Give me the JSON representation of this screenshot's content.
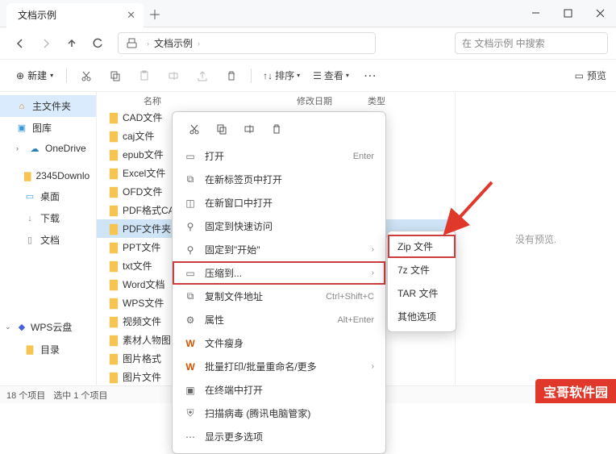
{
  "titlebar": {
    "tab_title": "文档示例"
  },
  "nav": {
    "breadcrumb_label": "文档示例",
    "search_placeholder": "在 文档示例 中搜索"
  },
  "toolbar": {
    "new_label": "新建",
    "sort_label": "排序",
    "view_label": "查看",
    "preview_label": "预览"
  },
  "columns": {
    "name": "名称",
    "date": "修改日期",
    "type": "类型"
  },
  "sidebar": {
    "items": [
      {
        "label": "主文件夹",
        "icon": "house"
      },
      {
        "label": "图库",
        "icon": "picture"
      },
      {
        "label": "OneDrive",
        "icon": "cloud"
      },
      {
        "label": "2345Downlo",
        "icon": "folder"
      },
      {
        "label": "桌面",
        "icon": "desktop"
      },
      {
        "label": "下载",
        "icon": "download"
      },
      {
        "label": "文档",
        "icon": "document"
      }
    ],
    "group": {
      "label": "WPS云盘",
      "icon": "wps"
    },
    "catalog_label": "目录"
  },
  "files": [
    "CAD文件",
    "caj文件",
    "epub文件",
    "Excel文件",
    "OFD文件",
    "PDF格式CA",
    "PDF文件夹",
    "PPT文件",
    "txt文件",
    "Word文档",
    "WPS文件",
    "视频文件",
    "素材人物图",
    "图片格式",
    "图片文件"
  ],
  "selected_file_index": 6,
  "context_menu": {
    "items": [
      {
        "label": "打开",
        "shortcut": "Enter",
        "icon": "open"
      },
      {
        "label": "在新标签页中打开",
        "icon": "tab"
      },
      {
        "label": "在新窗口中打开",
        "icon": "window"
      },
      {
        "label": "固定到快速访问",
        "icon": "pin"
      },
      {
        "label": "固定到\"开始\"",
        "icon": "pin-start",
        "arrow": true
      },
      {
        "label": "压缩到...",
        "icon": "compress",
        "arrow": true,
        "highlight": true
      },
      {
        "label": "复制文件地址",
        "shortcut": "Ctrl+Shift+C",
        "icon": "copy-path"
      },
      {
        "label": "属性",
        "shortcut": "Alt+Enter",
        "icon": "properties"
      },
      {
        "label": "文件瘦身",
        "icon": "w-slim"
      },
      {
        "label": "批量打印/批量重命名/更多",
        "icon": "w-batch",
        "arrow": true
      },
      {
        "label": "在终端中打开",
        "icon": "terminal"
      },
      {
        "label": "扫描病毒 (腾讯电脑管家)",
        "icon": "shield"
      },
      {
        "label": "显示更多选项",
        "icon": "more"
      }
    ]
  },
  "submenu": {
    "items": [
      "Zip 文件",
      "7z 文件",
      "TAR 文件",
      "其他选项"
    ],
    "selected": 0
  },
  "preview_text": "没有预览.",
  "status": {
    "count": "18 个项目",
    "selected": "选中 1 个项目"
  },
  "watermark": "宝哥软件园"
}
